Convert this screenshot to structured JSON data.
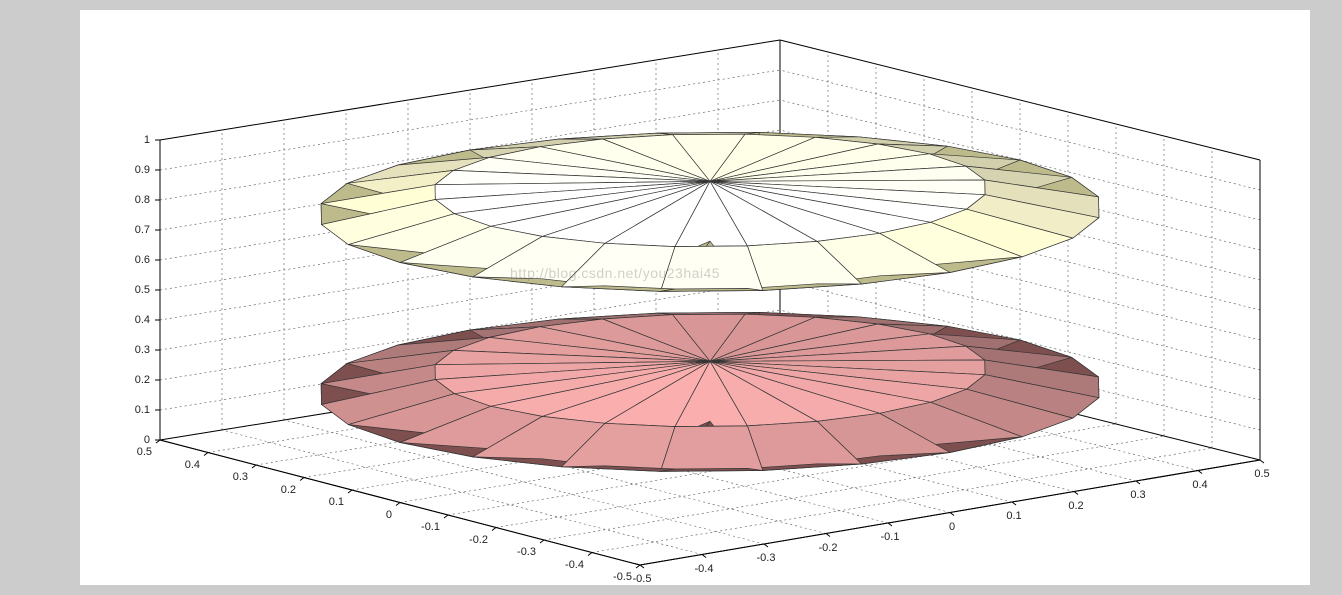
{
  "chart_data": {
    "type": "surface-3d",
    "description": "Two stacked flattened ellipsoids (lens-shaped disks) rendered as faceted 3D surfaces with wireframe edges",
    "surfaces": [
      {
        "name": "upper-ellipsoid",
        "center_z": 0.8,
        "radius_xy": 0.5,
        "radius_z": 0.1,
        "color_top": "#f0edc6",
        "color_side": "#d8d4a0",
        "radial_segments": 24,
        "vertical_segments": 4
      },
      {
        "name": "lower-ellipsoid",
        "center_z": 0.2,
        "radius_xy": 0.5,
        "radius_z": 0.1,
        "color_top": "#b88080",
        "color_side": "#8f5a5a",
        "radial_segments": 24,
        "vertical_segments": 4
      }
    ],
    "axes": {
      "x": {
        "min": -0.5,
        "max": 0.5,
        "ticks": [
          -0.5,
          -0.4,
          -0.3,
          -0.2,
          -0.1,
          0,
          0.1,
          0.2,
          0.3,
          0.4,
          0.5
        ]
      },
      "y": {
        "min": -0.5,
        "max": 0.5,
        "ticks": [
          -0.5,
          -0.4,
          -0.3,
          -0.2,
          -0.1,
          0,
          0.1,
          0.2,
          0.3,
          0.4,
          0.5
        ]
      },
      "z": {
        "min": 0,
        "max": 1,
        "ticks": [
          0,
          0.1,
          0.2,
          0.3,
          0.4,
          0.5,
          0.6,
          0.7,
          0.8,
          0.9,
          1
        ]
      }
    },
    "grid": true,
    "grid_style": "dashed",
    "background": "#ffffff",
    "figure_background": "#cccccc",
    "view": {
      "azimuth": -37.5,
      "elevation": 30
    }
  },
  "watermark": "http://blog.csdn.net/you23hai45",
  "labels": {
    "z_ticks": [
      "0",
      "0.1",
      "0.2",
      "0.3",
      "0.4",
      "0.5",
      "0.6",
      "0.7",
      "0.8",
      "0.9",
      "1"
    ],
    "y_ticks": [
      "0.5",
      "0.4",
      "0.3",
      "0.2",
      "0.1",
      "0",
      "-0.1",
      "-0.2",
      "-0.3",
      "-0.4",
      "-0.5"
    ],
    "x_ticks": [
      "-0.5",
      "-0.4",
      "-0.3",
      "-0.2",
      "-0.1",
      "0",
      "0.1",
      "0.2",
      "0.3",
      "0.4",
      "0.5"
    ]
  }
}
